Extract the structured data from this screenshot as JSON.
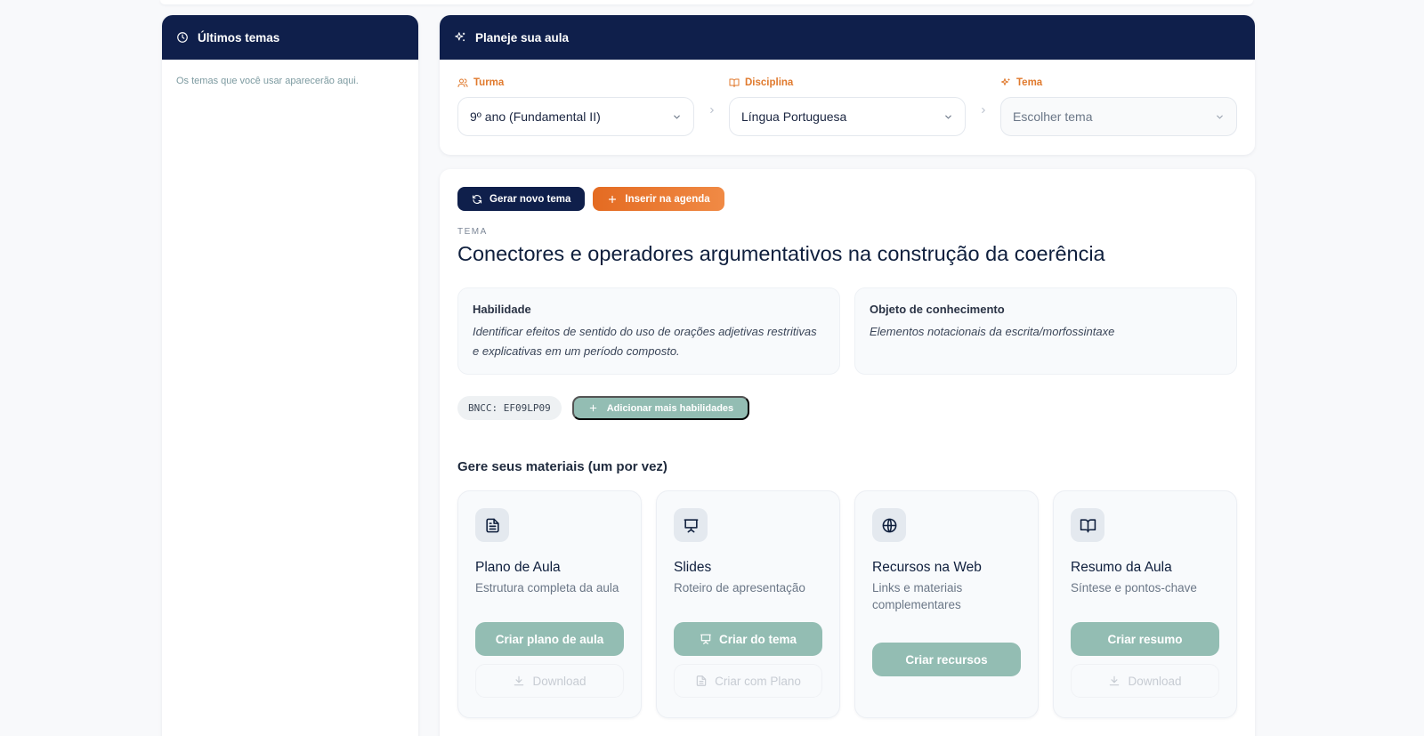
{
  "recent": {
    "title": "Últimos temas",
    "empty_text": "Os temas que você usar aparecerão aqui.",
    "icon": "clock-icon"
  },
  "plan": {
    "title": "Planeje sua aula",
    "icon": "sparkles-icon",
    "turma": {
      "label": "Turma",
      "value": "9º ano (Fundamental II)",
      "icon": "users-icon"
    },
    "disciplina": {
      "label": "Disciplina",
      "value": "Língua Portuguesa",
      "icon": "book-open-icon"
    },
    "tema": {
      "label": "Tema",
      "value": "Escolher tema",
      "icon": "sparkles-icon"
    }
  },
  "actions": {
    "generate_label": "Gerar novo tema",
    "schedule_label": "Inserir na agenda"
  },
  "topic": {
    "eyebrow": "TEMA",
    "title": "Conectores e operadores argumentativos na construção da coerência",
    "skill_title": "Habilidade",
    "skill_text": "Identificar efeitos de sentido do uso de orações adjetivas restritivas e explicativas em um período composto.",
    "object_title": "Objeto de conhecimento",
    "object_text": "Elementos notacionais da escrita/morfossintaxe",
    "bncc_tag": "BNCC: EF09LP09",
    "add_skills_label": "Adicionar mais habilidades"
  },
  "materials": {
    "title": "Gere seus materiais (um por vez)",
    "cards": [
      {
        "title": "Plano de Aula",
        "desc": "Estrutura completa da aula",
        "primary": "Criar plano de aula",
        "secondary": "Download",
        "icon": "file-text-icon"
      },
      {
        "title": "Slides",
        "desc": "Roteiro de apresentação",
        "primary": "Criar do tema",
        "secondary": "Criar com Plano",
        "icon": "presentation-icon"
      },
      {
        "title": "Recursos na Web",
        "desc": "Links e materiais complementares",
        "primary": "Criar recursos",
        "icon": "globe-icon"
      },
      {
        "title": "Resumo da Aula",
        "desc": "Síntese e pontos-chave",
        "primary": "Criar resumo",
        "secondary": "Download",
        "icon": "book-open-icon"
      }
    ]
  },
  "colors": {
    "navy": "#0f1f4b",
    "orange": "#e07a2e",
    "sage": "#93bdb3"
  }
}
